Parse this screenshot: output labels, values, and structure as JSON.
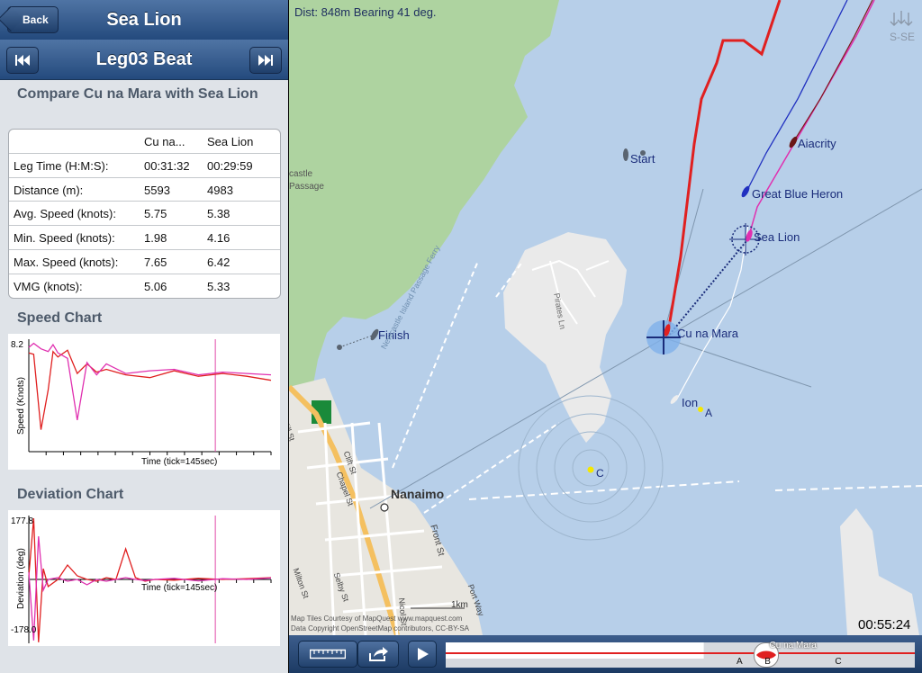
{
  "header": {
    "back_label": "Back",
    "title": "Sea Lion"
  },
  "leg_nav": {
    "title": "Leg03 Beat",
    "prev_icon": "skip-back-icon",
    "next_icon": "skip-forward-icon"
  },
  "compare": {
    "heading": "Compare Cu na Mara with Sea Lion",
    "columns": [
      "",
      "Cu na...",
      "Sea Lion"
    ],
    "rows": [
      {
        "label": "Leg Time (H:M:S):",
        "a": "00:31:32",
        "b": "00:29:59"
      },
      {
        "label": "Distance (m):",
        "a": "5593",
        "b": "4983"
      },
      {
        "label": "Avg. Speed (knots):",
        "a": "5.75",
        "b": "5.38"
      },
      {
        "label": "Min. Speed (knots):",
        "a": "1.98",
        "b": "4.16"
      },
      {
        "label": "Max. Speed (knots):",
        "a": "7.65",
        "b": "6.42"
      },
      {
        "label": "VMG (knots):",
        "a": "5.06",
        "b": "5.33"
      }
    ]
  },
  "speed_chart": {
    "heading": "Speed Chart",
    "ymax_label": "8.2",
    "ylabel": "Speed (Knots)",
    "xlabel": "Time (tick=145sec)"
  },
  "deviation_chart": {
    "heading": "Deviation Chart",
    "ymax_label": "177.8",
    "ymin_label": "-178.0",
    "ylabel": "Deviation (deg)",
    "xlabel": "Time (tick=145sec)"
  },
  "chart_data": [
    {
      "type": "line",
      "title": "Speed Chart",
      "ylabel": "Speed (Knots)",
      "xlabel": "Time (tick=145sec)",
      "ylim": [
        0,
        8.2
      ],
      "x": [
        0,
        2,
        5,
        8,
        10,
        12,
        16,
        20,
        24,
        28,
        32,
        40,
        50,
        60,
        70,
        80,
        90,
        100
      ],
      "series": [
        {
          "name": "Cu na Mara",
          "color": "#e02020",
          "values": [
            7.2,
            7.1,
            1.6,
            4.5,
            7.3,
            6.9,
            7.4,
            5.7,
            6.4,
            5.8,
            6.0,
            5.6,
            5.4,
            5.9,
            5.5,
            5.7,
            5.5,
            5.2
          ]
        },
        {
          "name": "Sea Lion",
          "color": "#e030b0",
          "values": [
            7.6,
            7.9,
            7.5,
            7.3,
            7.8,
            7.2,
            6.8,
            2.3,
            6.5,
            5.6,
            6.4,
            5.7,
            5.9,
            6.0,
            5.6,
            5.8,
            5.7,
            5.6
          ]
        }
      ],
      "marker_x": 77,
      "marker_color": "#e04aa8"
    },
    {
      "type": "line",
      "title": "Deviation Chart",
      "ylabel": "Deviation (deg)",
      "xlabel": "Time (tick=145sec)",
      "ylim": [
        -178.0,
        177.8
      ],
      "x": [
        0,
        2,
        4,
        6,
        8,
        12,
        16,
        20,
        24,
        28,
        32,
        36,
        40,
        44,
        48,
        52,
        60,
        70,
        80,
        90,
        100
      ],
      "series": [
        {
          "name": "Cu na Mara",
          "color": "#e02020",
          "values": [
            10,
            170,
            -175,
            30,
            -20,
            0,
            40,
            10,
            0,
            -5,
            5,
            0,
            85,
            5,
            -5,
            0,
            -2,
            3,
            0,
            2,
            5
          ]
        },
        {
          "name": "Sea Lion",
          "color": "#e030b0",
          "values": [
            20,
            -170,
            120,
            -30,
            0,
            5,
            -5,
            0,
            -15,
            0,
            -5,
            0,
            5,
            0,
            -3,
            0,
            3,
            -4,
            2,
            0,
            4
          ]
        }
      ],
      "marker_x": 77,
      "marker_color": "#e04aa8"
    }
  ],
  "map": {
    "dist_text": "Dist: 848m Bearing 41 deg.",
    "wind_label": "S-SE",
    "wind_icon": "wind-arrows-icon",
    "labels": {
      "start": "Start",
      "finish": "Finish",
      "aiacrity": "Aiacrity",
      "heron": "Great Blue Heron",
      "sealion": "Sea Lion",
      "cunamara": "Cu na Mara",
      "ion": "Ion",
      "mark_a": "A",
      "mark_c": "C",
      "nanaimo": "Nanaimo",
      "passage": "castle Passage",
      "ferry": "Newcastle Island Passage Ferry",
      "pirates": "Pirates Ln",
      "mill": "Mill St",
      "front": "Front St",
      "chapel": "Chapel St",
      "clift": "Clift St",
      "milton": "Milton St",
      "selby": "Selby St",
      "port": "Port Way",
      "nicol": "Nicol St",
      "scale": "1km",
      "credit1": "Map Tiles Courtesy of MapQuest www.mapquest.com",
      "credit2": "Data Copyright OpenStreetMap contributors, CC-BY-SA"
    },
    "timer": "00:55:24"
  },
  "toolbar": {
    "ruler_icon": "ruler-icon",
    "share_icon": "share-icon",
    "play_icon": "play-icon",
    "boat_label": "Cu na Mara",
    "marks": [
      "A",
      "B",
      "C"
    ],
    "progress": 0.55
  },
  "colors": {
    "cunamara": "#e02020",
    "sealion": "#e030b0",
    "heron": "#2030c0",
    "nav": "#244a7d"
  }
}
